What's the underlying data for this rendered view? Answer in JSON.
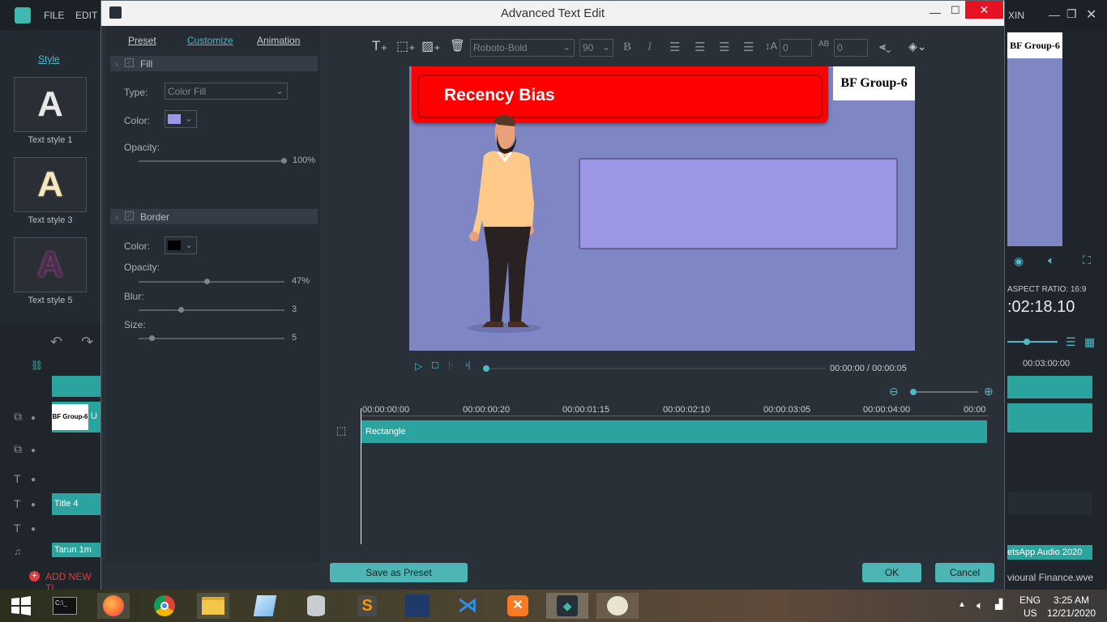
{
  "bg_app": {
    "menu": [
      "FILE",
      "EDIT"
    ],
    "right_menu_fragment": "XIN",
    "style_link": "Style",
    "styles": [
      "Text style 1",
      "Text style 3",
      "Text style 5"
    ],
    "preview_label": "BF Group-6",
    "aspect_ratio": "ASPECT RATIO: 16:9",
    "timecode": ":02:18.10",
    "timeline_marker": "00:03:00:00",
    "track_labels": [
      "BF Group-6",
      "U",
      "Title 4",
      "Tarun 1m"
    ],
    "add_new": "ADD NEW TI",
    "audio_track": "etsApp Audio 2020",
    "project_file": "vioural Finance.wve"
  },
  "dialog": {
    "title": "Advanced Text Edit",
    "tabs": {
      "preset": "Preset",
      "customize": "Customize",
      "animation": "Animation"
    },
    "fill": {
      "header": "Fill",
      "type_label": "Type:",
      "type_value": "Color Fill",
      "color_label": "Color:",
      "color": "#9b96e6",
      "opacity_label": "Opacity:",
      "opacity": "100%",
      "opacity_value": 1.0
    },
    "border": {
      "header": "Border",
      "color_label": "Color:",
      "color": "#000000",
      "opacity_label": "Opacity:",
      "opacity": "47%",
      "opacity_value": 0.47,
      "blur_label": "Blur:",
      "blur": "3",
      "size_label": "Size:",
      "size": "5"
    },
    "toolbar": {
      "font": "Roboto-Bold",
      "font_size": "90",
      "line_spacing": "0",
      "char_spacing": "0"
    },
    "preview": {
      "banner_text": "Recency Bias",
      "badge_text": "BF Group-6",
      "time": "00:00:00 / 00:00:05"
    },
    "timeline": {
      "ticks": [
        "00:00:00:00",
        "00:00:00:20",
        "00:00:01:15",
        "00:00:02:10",
        "00:00:03:05",
        "00:00:04:00",
        "00:00"
      ],
      "clip_label": "Rectangle"
    },
    "buttons": {
      "save_preset": "Save as Preset",
      "ok": "OK",
      "cancel": "Cancel"
    }
  },
  "taskbar": {
    "language": "ENG",
    "region": "US",
    "time": "3:25 AM",
    "date": "12/21/2020"
  },
  "colors": {
    "accent": "#4db6b4",
    "banner_red": "#ff0000",
    "preview_bg": "#7f86c4"
  }
}
